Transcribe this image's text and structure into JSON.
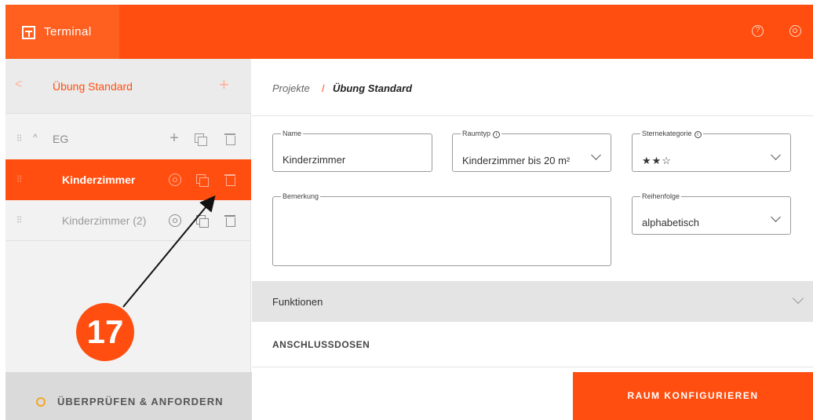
{
  "header": {
    "app_title": "Terminal",
    "help_icon": "help-circle-icon",
    "settings_icon": "settings-icon",
    "help_glyph": "?"
  },
  "sidebar": {
    "back_glyph": "<",
    "project_name": "Übung Standard",
    "add_glyph": "+",
    "floor": {
      "drag_glyph": "⁝⁝",
      "caret_glyph": "^",
      "label": "EG",
      "add_glyph": "+"
    },
    "rooms": [
      {
        "drag_glyph": "⁝⁝",
        "label": "Kinderzimmer",
        "selected": true
      },
      {
        "drag_glyph": "⁝⁝",
        "label": "Kinderzimmer (2)",
        "selected": false
      }
    ],
    "annotation_number": "17",
    "footer_label": "ÜBERPRÜFEN & ANFORDERN"
  },
  "breadcrumb": {
    "projects": "Projekte",
    "separator": "/",
    "current": "Übung Standard"
  },
  "form": {
    "name": {
      "legend": "Name",
      "value": "Kinderzimmer"
    },
    "raumtyp": {
      "legend": "Raumtyp",
      "info_glyph": "i",
      "value": "Kinderzimmer bis 20 m²"
    },
    "sterne": {
      "legend": "Sternekategorie",
      "info_glyph": "i",
      "value": "★★☆"
    },
    "bemerkung": {
      "legend": "Bemerkung",
      "value": ""
    },
    "reihenfolge": {
      "legend": "Reihenfolge",
      "value": "alphabetisch"
    }
  },
  "sections": {
    "funktionen": "Funktionen",
    "anschlussdosen": "ANSCHLUSSDOSEN"
  },
  "actions": {
    "configure": "RAUM KONFIGURIEREN"
  },
  "colors": {
    "accent": "#ff4e0f",
    "status_ring": "#f5a623"
  }
}
